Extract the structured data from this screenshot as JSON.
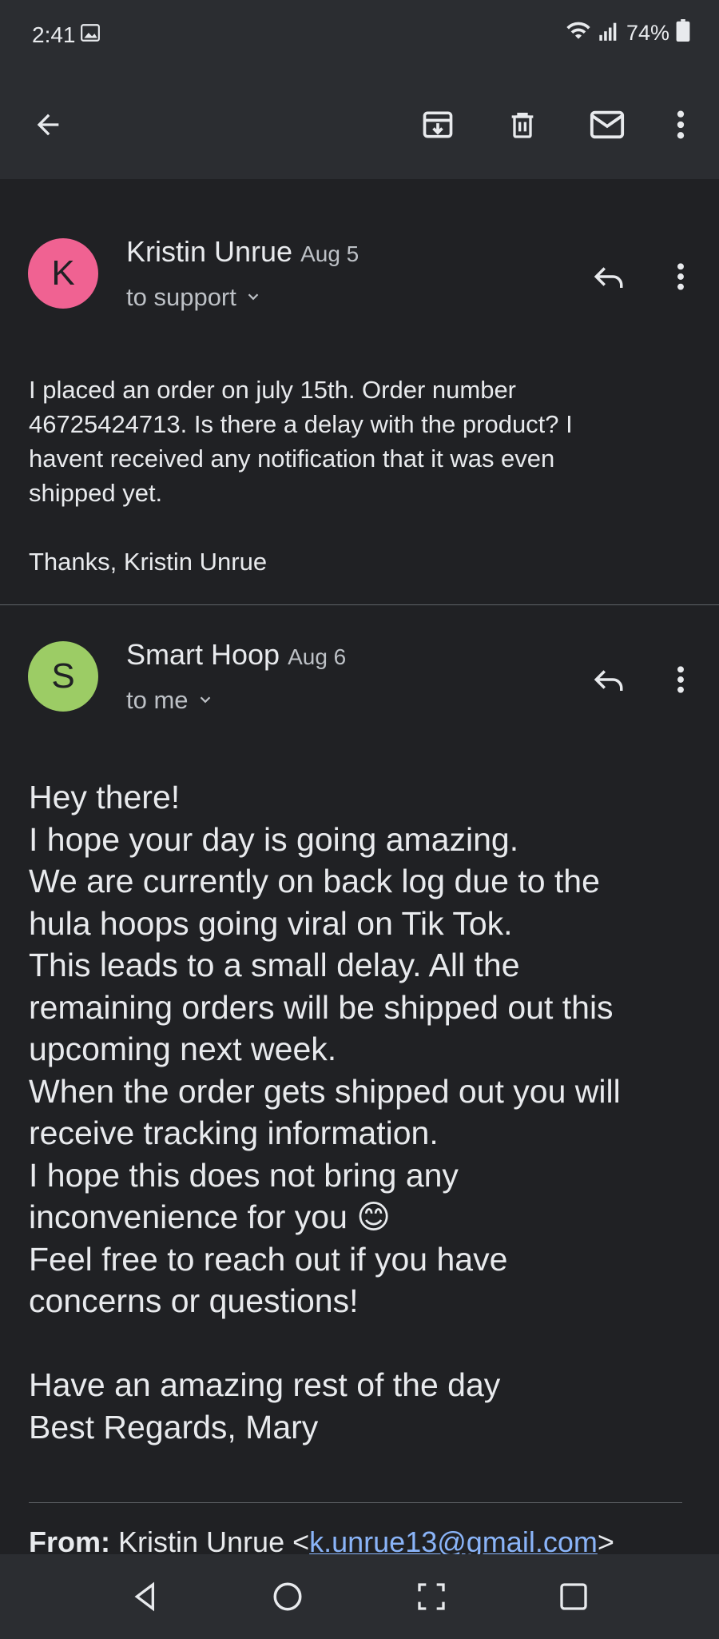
{
  "status_bar": {
    "time": "2:41",
    "battery": "74%",
    "icons": [
      "image-icon",
      "wifi-icon",
      "signal-icon",
      "battery-icon"
    ]
  },
  "toolbar": {
    "icons": [
      "back-arrow-icon",
      "archive-icon",
      "delete-icon",
      "mark-unread-icon",
      "more-vert-icon"
    ]
  },
  "messages": [
    {
      "avatar_letter": "K",
      "avatar_color": "#f06292",
      "sender": "Kristin Unrue",
      "date": "Aug 5",
      "recipient": "to support",
      "body": "I placed an order on july 15th. Order number\n46725424713. Is there a delay with the product? I\nhavent received any notification that it was even\nshipped yet.\n\nThanks, Kristin Unrue"
    },
    {
      "avatar_letter": "S",
      "avatar_color": "#9ccc65",
      "sender": "Smart Hoop",
      "date": "Aug 6",
      "recipient": "to me",
      "body": "Hey there!\nI hope your day is going amazing.\nWe are currently on back log due to the\nhula hoops going viral on Tik Tok.\nThis leads to a small delay. All the\nremaining orders will be shipped out this\nupcoming next week.\nWhen the order gets shipped out you will\nreceive tracking information.\nI hope this does not bring any\ninconvenience for you 😊\nFeel free to reach out if you have\nconcerns or questions!\n\nHave an amazing rest of the day\nBest Regards, Mary"
    }
  ],
  "quoted": {
    "from_label": "From:",
    "from_name": "Kristin Unrue <",
    "from_email": "k.unrue13@gmail.com",
    "from_close": ">"
  },
  "colors": {
    "background": "#202124",
    "bars": "#2b2d31",
    "link": "#8ab4f8"
  }
}
